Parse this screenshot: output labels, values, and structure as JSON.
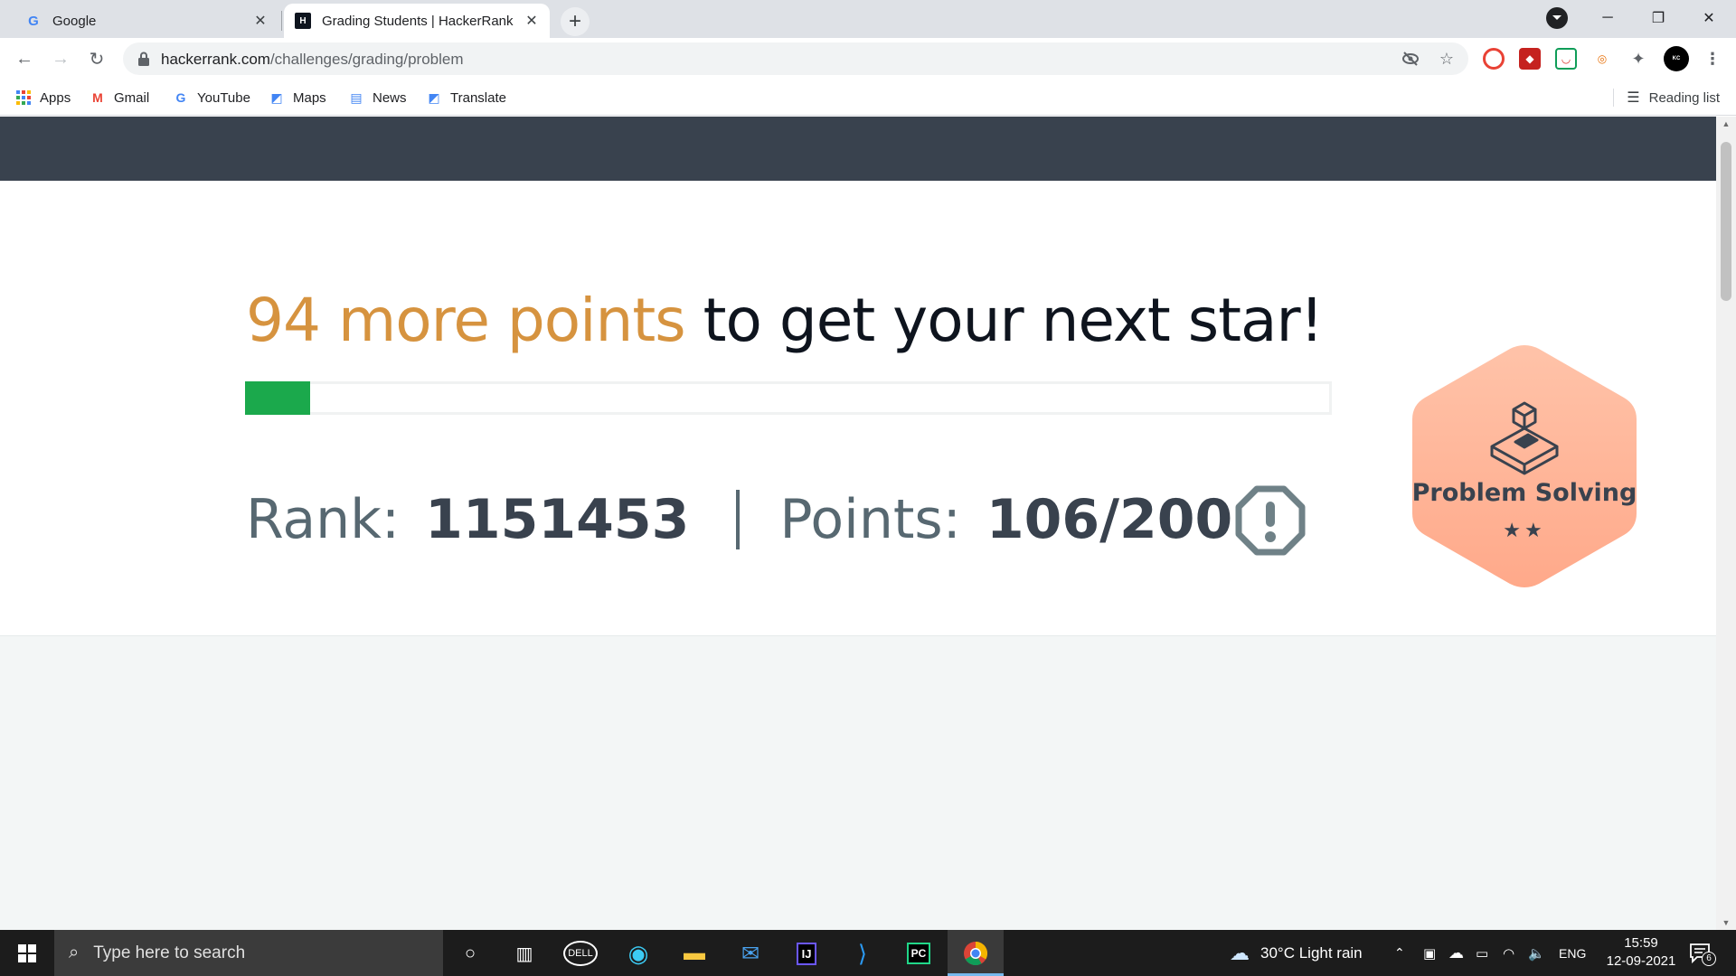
{
  "browser": {
    "tabs": [
      {
        "title": "Google",
        "active": false
      },
      {
        "title": "Grading Students | HackerRank",
        "active": true
      }
    ],
    "url_host": "hackerrank.com",
    "url_path": "/challenges/grading/problem",
    "bookmarks": [
      "Apps",
      "Gmail",
      "YouTube",
      "Maps",
      "News",
      "Translate"
    ],
    "reading_list": "Reading list"
  },
  "page": {
    "headline_highlight": "94 more points",
    "headline_rest": " to get your next star!",
    "progress_fraction": 0.06,
    "rank_label": "Rank:",
    "rank_value": "1151453",
    "points_label": "Points:",
    "points_value": "106/200",
    "badge_label": "Problem Solving",
    "badge_stars": "★★",
    "colors": {
      "header": "#39424e",
      "highlight": "#d6933f",
      "progress": "#1ba94c",
      "badge": "#ffa98a"
    }
  },
  "taskbar": {
    "search_placeholder": "Type here to search",
    "weather": "30°C  Light rain",
    "language": "ENG",
    "time": "15:59",
    "date": "12-09-2021",
    "notifications": "6"
  }
}
